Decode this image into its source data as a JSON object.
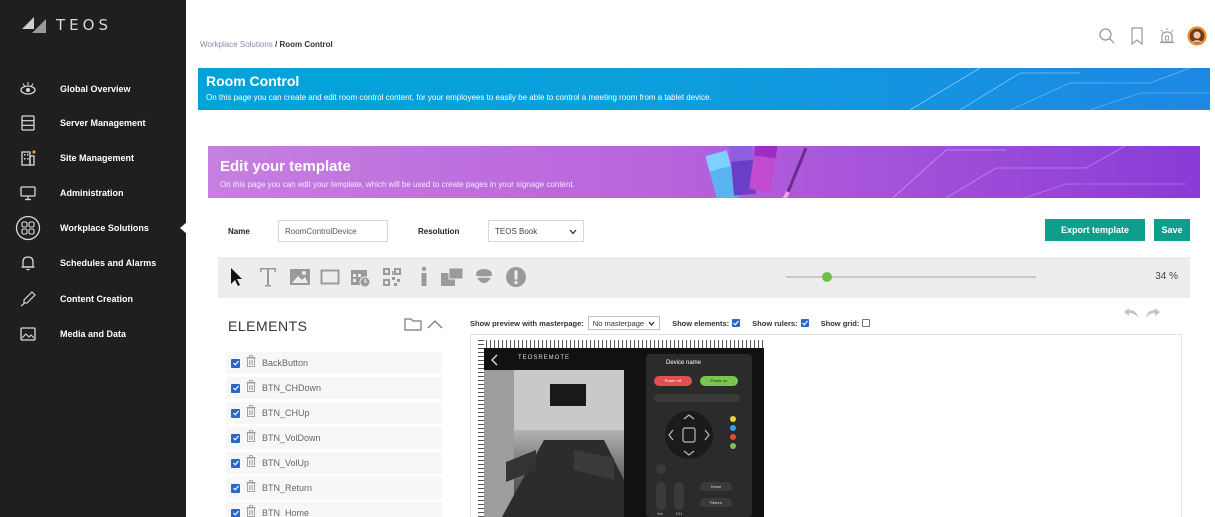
{
  "app": {
    "logo_text": "TEOS"
  },
  "sidebar": {
    "items": [
      {
        "label": "Global Overview",
        "icon": "eye-icon"
      },
      {
        "label": "Server Management",
        "icon": "server-icon"
      },
      {
        "label": "Site Management",
        "icon": "building-icon"
      },
      {
        "label": "Administration",
        "icon": "monitor-icon"
      },
      {
        "label": "Workplace Solutions",
        "icon": "grid-circle-icon",
        "active": true
      },
      {
        "label": "Schedules and Alarms",
        "icon": "bell-icon"
      },
      {
        "label": "Content Creation",
        "icon": "pen-icon"
      },
      {
        "label": "Media and Data",
        "icon": "image-icon"
      }
    ]
  },
  "header": {
    "breadcrumb_parent": "Workplace Solutions",
    "breadcrumb_sep": " / ",
    "breadcrumb_current": "Room Control",
    "icons": [
      "search-icon",
      "bookmark-icon",
      "alarm-icon",
      "avatar"
    ]
  },
  "banner": {
    "title": "Room Control",
    "subtitle": "On this page you can create and edit room control content, for your employees to easily be able to control a meeting room from a tablet device."
  },
  "template_banner": {
    "title": "Edit your template",
    "subtitle": "On this page you can edit your template, which will be used to create pages in your signage content."
  },
  "form": {
    "name_label": "Name",
    "name_value": "RoomControlDevice",
    "resolution_label": "Resolution",
    "resolution_value": "TEOS Book",
    "export_label": "Export template",
    "save_label": "Save"
  },
  "toolbar": {
    "tools": [
      "pointer-icon",
      "text-icon",
      "image-icon",
      "rectangle-icon",
      "calendar-icon",
      "qr-code-icon",
      "info-icon",
      "layout-icon",
      "shape-icon",
      "alert-icon"
    ],
    "zoom_value": "34 %",
    "zoom_level": 0.34
  },
  "elements": {
    "title": "ELEMENTS",
    "items": [
      "BackButton",
      "BTN_CHDown",
      "BTN_CHUp",
      "BTN_VolDown",
      "BTN_VolUp",
      "BTN_Return",
      "BTN_Home"
    ]
  },
  "preview": {
    "masterpage_label": "Show preview with masterpage:",
    "masterpage_value": "No masterpage",
    "show_elements_label": "Show elements:",
    "show_elements_checked": true,
    "show_rulers_label": "Show rulers:",
    "show_rulers_checked": true,
    "show_grid_label": "Show grid:",
    "show_grid_checked": false
  },
  "device": {
    "brand_text": "TEOSREMOTE",
    "device_name": "Device name",
    "power_off": "Power off",
    "power_on": "Power on",
    "vol_label": "Vol",
    "ch_label": "CH",
    "home_label": "Home",
    "return_label": "Return"
  },
  "colors": {
    "sidebar": "#1f1f1f",
    "accent_green": "#0e9f8c",
    "banner_blue": "#00a3d9",
    "template_purple": "#b864dc",
    "checkbox_blue": "#2a67c9",
    "slider_green": "#6cc04a"
  }
}
